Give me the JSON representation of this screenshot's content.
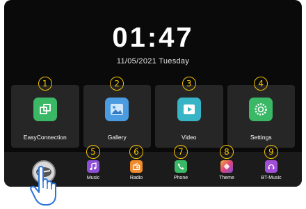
{
  "clock": {
    "time": "01:47",
    "date": "11/05/2021 Tuesday"
  },
  "tiles": [
    {
      "number": "1",
      "label": "EasyConnection",
      "icon": "easyconnection-icon",
      "color": "#3ab866"
    },
    {
      "number": "2",
      "label": "Gallery",
      "icon": "gallery-icon",
      "color": "#4b9be0"
    },
    {
      "number": "3",
      "label": "Video",
      "icon": "video-icon",
      "color": "#38b4c7"
    },
    {
      "number": "4",
      "label": "Settings",
      "icon": "gear-icon",
      "color": "#3ab866"
    }
  ],
  "dock": [
    {
      "number": "5",
      "label": "Music",
      "icon": "music-icon",
      "color": "#8c4fd6"
    },
    {
      "number": "6",
      "label": "Radio",
      "icon": "radio-icon",
      "color": "#f08a2c"
    },
    {
      "number": "7",
      "label": "Phone",
      "icon": "phone-icon",
      "color": "#3ab866"
    },
    {
      "number": "8",
      "label": "Theme",
      "icon": "theme-icon",
      "color": "#e0447a"
    },
    {
      "number": "9",
      "label": "BT-Music",
      "icon": "bluetooth-music-icon",
      "color": "#a04fd6"
    }
  ],
  "colors": {
    "accent": "#f6c400",
    "background": "#0a0a0a",
    "tile": "#262626",
    "hand": "#2a73d9"
  }
}
